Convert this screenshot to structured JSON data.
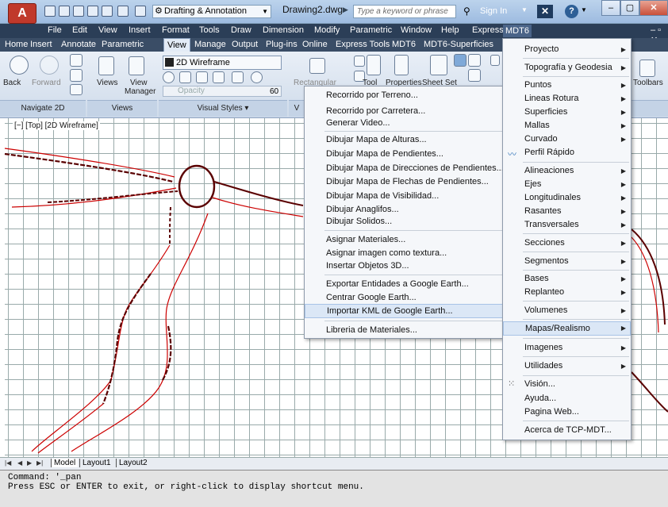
{
  "title_bar": {
    "logo_letter": "A",
    "workspace": "Drafting & Annotation",
    "document_title": "Drawing2.dwg",
    "search_placeholder": "Type a keyword or phrase",
    "sign_in": "Sign In"
  },
  "menu_bar": [
    "File",
    "Edit",
    "View",
    "Insert",
    "Format",
    "Tools",
    "Draw",
    "Dimension",
    "Modify",
    "Parametric",
    "Window",
    "Help",
    "Express",
    "MDT6"
  ],
  "ribbon_tabs": [
    "Home",
    "Insert",
    "Annotate",
    "Parametric",
    "View",
    "Manage",
    "Output",
    "Plug-ins",
    "Online",
    "Express Tools",
    "MDT6",
    "MDT6-Superficies"
  ],
  "ribbon": {
    "back": "Back",
    "forward": "Forward",
    "views": "Views",
    "view_manager_1": "View",
    "view_manager_2": "Manager",
    "visual_style": "2D Wireframe",
    "opacity": "Opacity",
    "opacity_value": "60",
    "rectangular": "Rectangular",
    "tool": "Tool",
    "properties": "Properties",
    "sheet_set": "Sheet Set",
    "toolbars": "Toolbars",
    "panel_navigate": "Navigate 2D",
    "panel_views": "Views",
    "panel_visual_styles": "Visual Styles ▾",
    "panel_v": "V"
  },
  "viewport_label": "[−] [Top] [2D Wireframe]",
  "submenu_items": [
    "Recorrido por Terreno...",
    "Recorrido por Carretera...",
    "Generar Video...",
    "Dibujar Mapa de Alturas...",
    "Dibujar Mapa de Pendientes...",
    "Dibujar Mapa de Direcciones de Pendientes...",
    "Dibujar Mapa de Flechas de Pendientes...",
    "Dibujar Mapa de Visibilidad...",
    "Dibujar Anaglifos...",
    "Dibujar Solidos...",
    "Asignar Materiales...",
    "Asignar imagen como textura...",
    "Insertar Objetos 3D...",
    "Exportar Entidades a Google Earth...",
    "Centrar Google Earth...",
    "Importar KML de Google Earth...",
    "Libreria de Materiales..."
  ],
  "mdt6_menu_items": [
    "Proyecto",
    "Topografía y Geodesia",
    "Puntos",
    "Lineas Rotura",
    "Superficies",
    "Mallas",
    "Curvado",
    "Perfil Rápido",
    "Alineaciones",
    "Ejes",
    "Longitudinales",
    "Rasantes",
    "Transversales",
    "Secciones",
    "Segmentos",
    "Bases",
    "Replanteo",
    "Volumenes",
    "Mapas/Realismo",
    "Imagenes",
    "Utilidades",
    "Visión...",
    "Ayuda...",
    "Pagina Web...",
    "Acerca de TCP-MDT..."
  ],
  "layout_tabs": [
    "Model",
    "Layout1",
    "Layout2"
  ],
  "command_line": {
    "line1": "Command: '_pan",
    "line2": "Press ESC or ENTER to exit, or right-click to display shortcut menu."
  },
  "colors": {
    "accent_menu_bar": "#2b3e57",
    "highlight": "#dbe7f6",
    "road_line": "#cc0000"
  }
}
